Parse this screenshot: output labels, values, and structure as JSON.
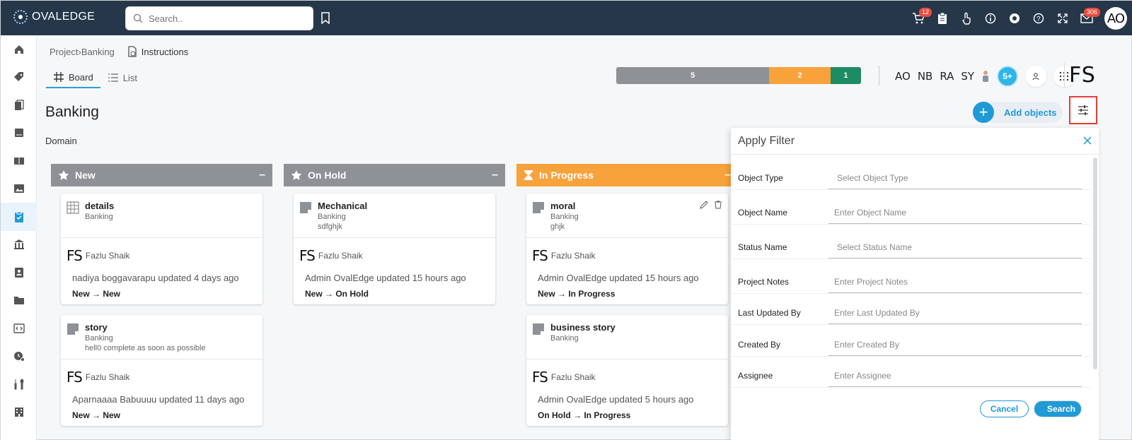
{
  "app": {
    "name": "OVALEDGE",
    "search_placeholder": "Search..",
    "cart_badge": "12",
    "mail_badge": "306",
    "user_initials": "AO"
  },
  "breadcrumb": {
    "root": "Project",
    "sep": "›",
    "current": "Banking",
    "instructions": "Instructions"
  },
  "tabs": [
    {
      "label": "Board"
    },
    {
      "label": "List"
    }
  ],
  "progress": [
    {
      "value": "5",
      "color": "#8e9196",
      "fraction": 0.625
    },
    {
      "value": "2",
      "color": "#f7a23b",
      "fraction": 0.25
    },
    {
      "value": "1",
      "color": "#1e8c63",
      "fraction": 0.125
    }
  ],
  "members": {
    "initials": [
      "AO",
      "NB",
      "RA",
      "SY"
    ],
    "more": "5+",
    "owner_initials": "FS"
  },
  "page": {
    "title": "Banking",
    "domain": "Domain",
    "add_objects": "Add objects"
  },
  "columns": [
    {
      "name": "New",
      "color": "#8e9196",
      "min": "–"
    },
    {
      "name": "On Hold",
      "color": "#8e9196",
      "min": "–"
    },
    {
      "name": "In Progress",
      "color": "#f7a23b",
      "min": "–"
    }
  ],
  "cards": {
    "c1": {
      "title": "details",
      "sub1": "Banking",
      "sub2": "",
      "initials": "FS",
      "assignee": "Fazlu Shaik",
      "updated": "nadiya boggavarapu updated 4 days ago",
      "transition": "New → New"
    },
    "c2": {
      "title": "story",
      "sub1": "Banking",
      "sub2": "hell0 complete as soon as possible",
      "initials": "FS",
      "assignee": "Fazlu Shaik",
      "updated": "Aparnaaaa Babuuuu updated 11 days ago",
      "transition": "New → New"
    },
    "c3": {
      "title": "Mechanical",
      "sub1": "Banking",
      "sub2": "sdfghjk",
      "initials": "FS",
      "assignee": "Fazlu Shaik",
      "updated": "Admin OvalEdge updated 15 hours ago",
      "transition": "New → On Hold"
    },
    "c4": {
      "title": "moral",
      "sub1": "Banking",
      "sub2": "ghjk",
      "initials": "FS",
      "assignee": "Fazlu Shaik",
      "updated": "Admin OvalEdge updated 15 hours ago",
      "transition": "New → In Progress"
    },
    "c5": {
      "title": "business story",
      "sub1": "Banking",
      "sub2": "",
      "initials": "FS",
      "assignee": "Fazlu Shaik",
      "updated": "Admin OvalEdge updated 5 hours ago",
      "transition": "On Hold → In Progress"
    }
  },
  "filter": {
    "title": "Apply Filter",
    "fields": [
      {
        "label": "Object Type",
        "placeholder": "Select Object Type"
      },
      {
        "label": "Object Name",
        "placeholder": "Enter Object Name"
      },
      {
        "label": "Status Name",
        "placeholder": "Select Status Name"
      },
      {
        "label": "Project Notes",
        "placeholder": "Enter Project Notes"
      },
      {
        "label": "Last Updated By",
        "placeholder": "Enter Last Updated By"
      },
      {
        "label": "Created By",
        "placeholder": "Enter Created By"
      },
      {
        "label": "Assignee",
        "placeholder": "Enter Assignee"
      }
    ],
    "cancel": "Cancel",
    "search": "Search"
  }
}
